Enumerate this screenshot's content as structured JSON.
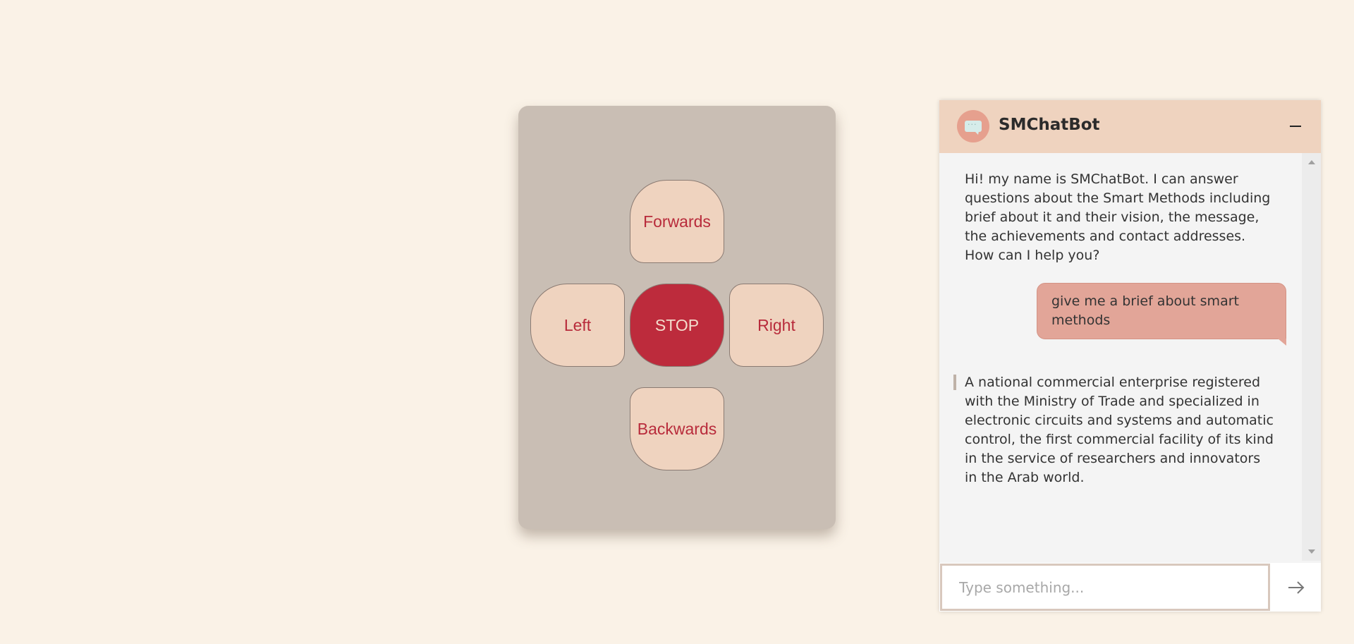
{
  "controller": {
    "forwards_label": "Forwards",
    "left_label": "Left",
    "stop_label": "STOP",
    "right_label": "Right",
    "backwards_label": "Backwards"
  },
  "chatbot": {
    "title": "SMChatBot",
    "avatar_icon": "chat-bubble-icon",
    "messages": [
      {
        "sender": "bot",
        "text": "Hi! my name is SMChatBot. I can answer questions about the Smart Methods including brief about it and their vision, the message, the achievements and contact addresses. How can I help you?"
      },
      {
        "sender": "user",
        "text": "give me a brief about smart methods"
      },
      {
        "sender": "bot",
        "text": "A national commercial enterprise registered with the Ministry of Trade and specialized in electronic circuits and systems and automatic control, the first commercial facility of its kind in the service of researchers and innovators in the Arab world."
      }
    ],
    "input": {
      "placeholder": "Type something...",
      "value": ""
    },
    "send_icon": "arrow-right-icon"
  },
  "colors": {
    "background": "#faf2e7",
    "controller_panel": "#c9beb4",
    "button_fill": "#efd3bf",
    "button_text": "#b82b3b",
    "stop_fill": "#bd2b3c",
    "user_bubble": "#e2a598",
    "header": "#efd3bf"
  }
}
